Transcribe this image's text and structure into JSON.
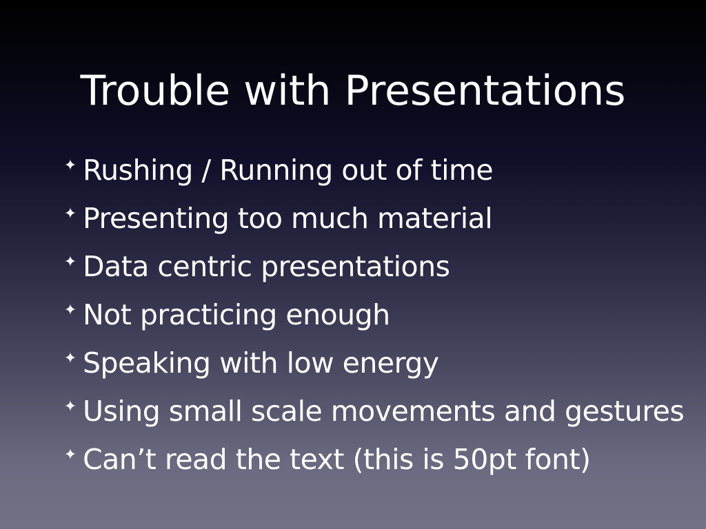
{
  "slide": {
    "title": "Trouble with Presentations",
    "bullet_icon": "four-pointed-star-icon",
    "bullet_glyph": "✦",
    "bullets": [
      "Rushing / Running out of time",
      "Presenting too much material",
      "Data centric presentations",
      "Not practicing enough",
      "Speaking with low energy",
      "Using small scale movements and gestures",
      "Can’t read the text (this is 50pt font)"
    ]
  },
  "colors": {
    "text": "#ffffff",
    "background_top": "#000000",
    "background_bottom": "#727286"
  }
}
